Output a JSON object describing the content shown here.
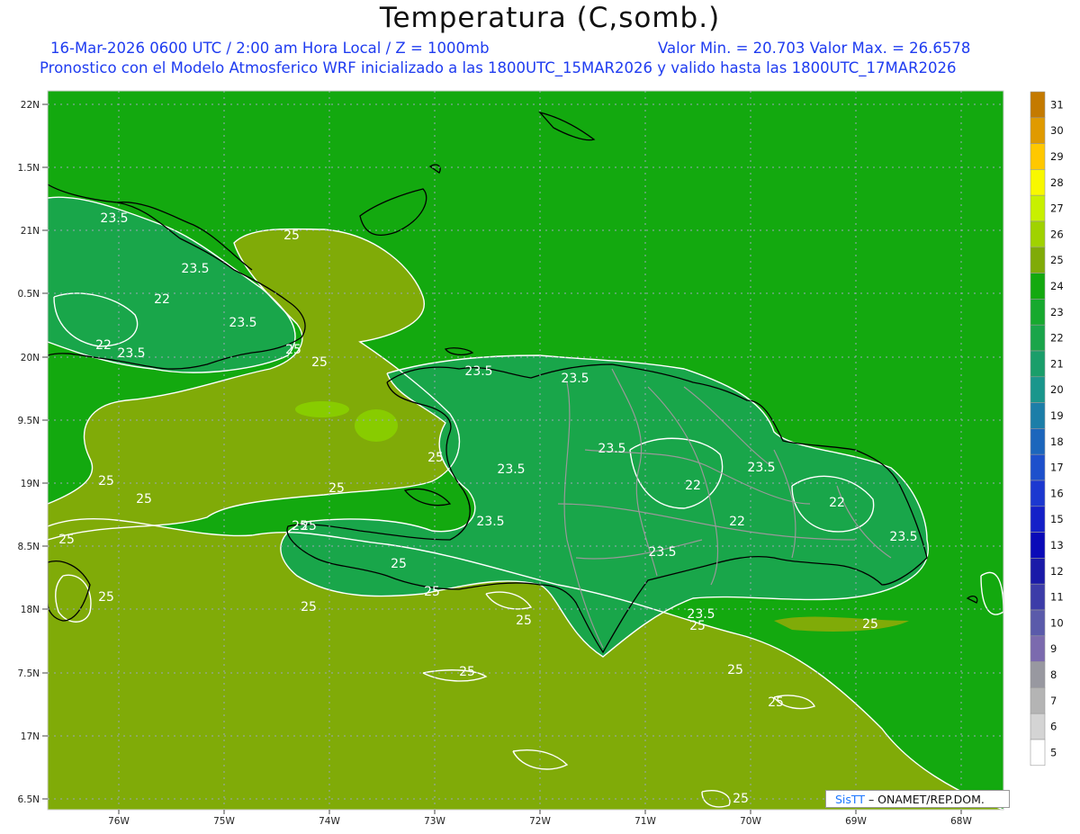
{
  "header": {
    "title": "Temperatura (C,somb.)",
    "line1_left": "16-Mar-2026  0600 UTC / 2:00 am Hora Local / Z = 1000mb",
    "line1_right": "Valor Min. = 20.703  Valor Max. = 26.6578",
    "line2": "Pronostico con el Modelo Atmosferico WRF inicializado a las 1800UTC_15MAR2026 y valido hasta las  1800UTC_17MAR2026"
  },
  "map": {
    "lat_labels": [
      "22N",
      "1.5N",
      "21N",
      "0.5N",
      "20N",
      "9.5N",
      "19N",
      "8.5N",
      "18N",
      "7.5N",
      "17N",
      "6.5N"
    ],
    "lon_labels": [
      "76W",
      "75W",
      "74W",
      "73W",
      "72W",
      "71W",
      "70W",
      "69W",
      "68W"
    ],
    "contour_labels": [
      "23.5",
      "23.5",
      "22",
      "22",
      "23.5",
      "23.5",
      "25",
      "25",
      "25",
      "25",
      "25",
      "25",
      "25",
      "25",
      "25",
      "23.5",
      "23.5",
      "23.5",
      "23.5",
      "23.5",
      "22",
      "22",
      "22",
      "23.5",
      "23.5",
      "23.5",
      "23.5",
      "25",
      "25",
      "25",
      "25",
      "25",
      "25",
      "25",
      "25",
      "25",
      "25",
      "25",
      "25"
    ],
    "colors": {
      "v22": "#19a64a",
      "v23": "#17a92e",
      "v24": "#13a90f",
      "v25": "#80ab08",
      "v26": "#88cc00",
      "coast": "#000000",
      "border": "#999999",
      "contour": "#ffffff"
    }
  },
  "colorbar": {
    "labels": [
      "31",
      "30",
      "29",
      "28",
      "27",
      "26",
      "25",
      "24",
      "23",
      "22",
      "21",
      "20",
      "19",
      "18",
      "17",
      "16",
      "15",
      "13",
      "12",
      "11",
      "10",
      "9",
      "8",
      "7",
      "6",
      "5"
    ],
    "colors": [
      "#c47a00",
      "#e09a00",
      "#ffc800",
      "#f8f800",
      "#c8f000",
      "#a0d200",
      "#80ab08",
      "#13a90f",
      "#17a92e",
      "#1aa54a",
      "#1a9e6a",
      "#1a968c",
      "#1c7ea8",
      "#1c66bc",
      "#1d50cc",
      "#1c38d0",
      "#1420c8",
      "#0a0ab8",
      "#1a1aa8",
      "#3c3ca8",
      "#5a5aaa",
      "#7b6aae",
      "#9898a0",
      "#b4b4b4",
      "#d4d4d4",
      "#ffffff"
    ]
  },
  "credit": {
    "brand": "SisTT",
    "text": " – ONAMET/REP.DOM."
  }
}
